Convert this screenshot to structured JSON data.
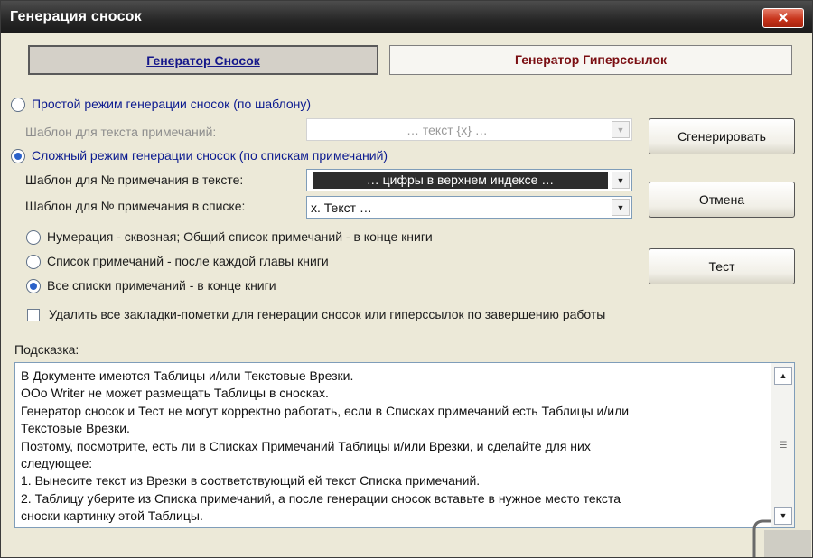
{
  "window": {
    "title": "Генерация сносок",
    "close_label": "✕"
  },
  "tabs": {
    "footnotes": "Генератор Сносок",
    "hyperlinks": "Генератор Гиперссылок"
  },
  "simple_mode": {
    "label": "Простой режим генерации сносок (по шаблону)",
    "selected": false
  },
  "simple_template": {
    "label": "Шаблон для текста примечаний:",
    "value": "… текст {x} …"
  },
  "complex_mode": {
    "label": "Сложный режим генерации сносок (по спискам примечаний)",
    "selected": true
  },
  "note_number_text": {
    "label": "Шаблон для № примечания в тексте:",
    "value": "… цифры в верхнем индексе …"
  },
  "note_number_list": {
    "label": "Шаблон для № примечания в списке:",
    "value": "x. Текст …"
  },
  "numbering_options": [
    {
      "label": "Нумерация - сквозная; Общий список примечаний - в конце книги",
      "selected": false
    },
    {
      "label": "Список примечаний - после каждой главы книги",
      "selected": false
    },
    {
      "label": "Все списки примечаний - в конце книги",
      "selected": true
    }
  ],
  "delete_bookmarks": {
    "label": "Удалить все закладки-пометки для генерации сносок или гиперссылок по завершению работы",
    "checked": false
  },
  "buttons": {
    "generate": "Сгенерировать",
    "cancel": "Отмена",
    "test": "Тест"
  },
  "hint": {
    "label": "Подсказка:",
    "lines": [
      "В Документе имеются Таблицы и/или Текстовые Врезки.",
      "OOo Writer не может размещать Таблицы в сносках.",
      "Генератор сносок и Тест не могут корректно работать, если в Списках примечаний есть Таблицы и/или",
      "Текстовые Врезки.",
      "Поэтому, посмотрите, есть ли в Списках Примечаний Таблицы и/или Врезки, и сделайте для них",
      "следующее:",
      "1. Вынесите текст из Врезки в соответствующий ей текст Списка примечаний.",
      "2. Таблицу уберите из Списка примечаний, а после генерации сносок вставьте в нужное место текста",
      "сноски картинку этой Таблицы."
    ]
  },
  "icons": {
    "scroll_up": "triangle-up-icon",
    "scroll_down": "triangle-down-icon",
    "scroll_grip": "grip-lines-icon",
    "dropdown": "triangle-down-icon"
  },
  "colors": {
    "titlebar": "#262626",
    "close": "#c7341b",
    "selected_radio": "#2a61c9",
    "hyperlinks_tab": "#7a0e12",
    "footnotes_tab": "#15178a",
    "highlight_combo": "#2d2d2d"
  }
}
